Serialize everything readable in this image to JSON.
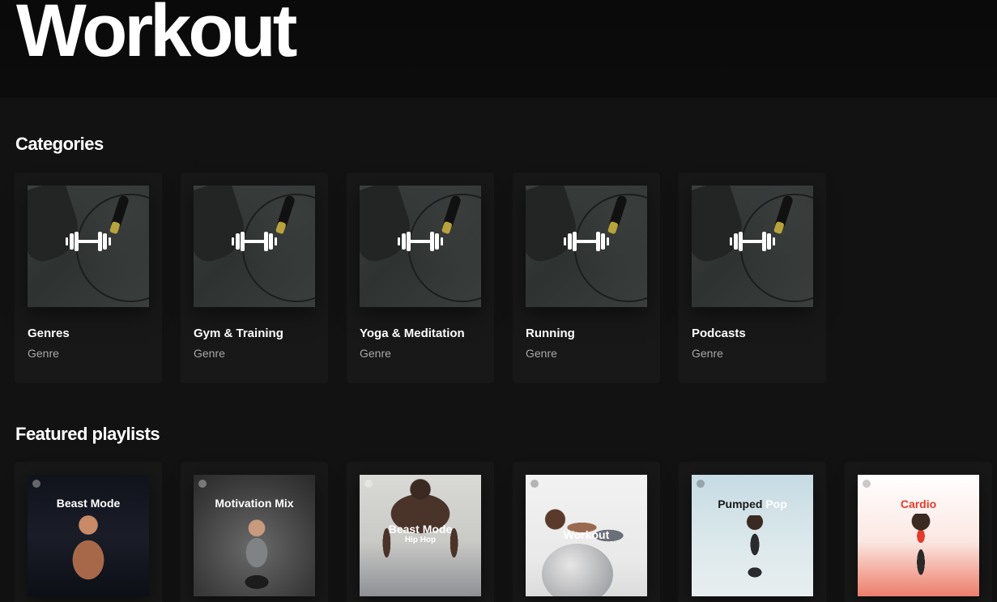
{
  "header": {
    "title": "Workout"
  },
  "sections": {
    "categories": {
      "title": "Categories",
      "items": [
        {
          "title": "Genres",
          "subtitle": "Genre",
          "icon": "dumbbell-icon"
        },
        {
          "title": "Gym & Training",
          "subtitle": "Genre",
          "icon": "dumbbell-icon"
        },
        {
          "title": "Yoga & Meditation",
          "subtitle": "Genre",
          "icon": "dumbbell-icon"
        },
        {
          "title": "Running",
          "subtitle": "Genre",
          "icon": "dumbbell-icon"
        },
        {
          "title": "Podcasts",
          "subtitle": "Genre",
          "icon": "dumbbell-icon"
        }
      ]
    },
    "featured": {
      "title": "Featured playlists",
      "items": [
        {
          "cover_text": "Beast Mode",
          "cover_color": "#ffffff"
        },
        {
          "cover_text": "Motivation Mix",
          "cover_color": "#ffffff"
        },
        {
          "cover_text": "Beast Mode",
          "cover_subtext": "Hip Hop",
          "cover_color": "#ffffff"
        },
        {
          "cover_text": "Workout",
          "cover_color": "#ffffff"
        },
        {
          "cover_text": "Pumped",
          "cover_text_2": "Pop",
          "cover_color": "#1a1a1a",
          "cover_color_2": "#ffffff"
        },
        {
          "cover_text": "Cardio",
          "cover_color": "#e53b2c"
        }
      ]
    }
  },
  "colors": {
    "background": "#121212",
    "card": "#181818",
    "subtext": "#a7a7a7"
  }
}
